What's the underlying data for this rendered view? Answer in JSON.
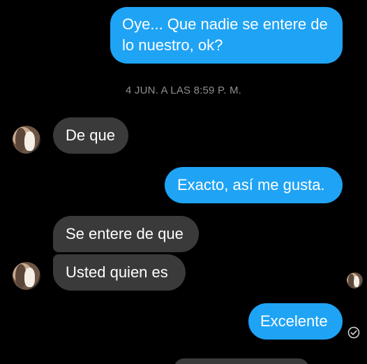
{
  "conversation": {
    "messages": [
      {
        "direction": "outgoing",
        "text": "Oye... Que nadie se entere de lo nuestro, ok?"
      },
      {
        "direction": "incoming",
        "text": "De que"
      },
      {
        "direction": "outgoing",
        "text": "Exacto, así me gusta."
      },
      {
        "direction": "incoming",
        "text": "Se entere de que"
      },
      {
        "direction": "incoming",
        "text": "Usted quien es"
      },
      {
        "direction": "outgoing",
        "text": "Excelente"
      },
      {
        "direction": "incoming",
        "text": ""
      }
    ],
    "timestamp": "4 JUN. A LAS 8:59 P. M."
  },
  "icons": {
    "contact_avatar": "contact-avatar-photo",
    "read_receipt_avatar": "read-receipt-avatar",
    "sent_status": "check-circle-icon"
  },
  "colors": {
    "background": "#000000",
    "outgoing_bubble": "#1fa3f5",
    "incoming_bubble": "#3a3a3b",
    "timestamp_text": "#8e8f93"
  }
}
